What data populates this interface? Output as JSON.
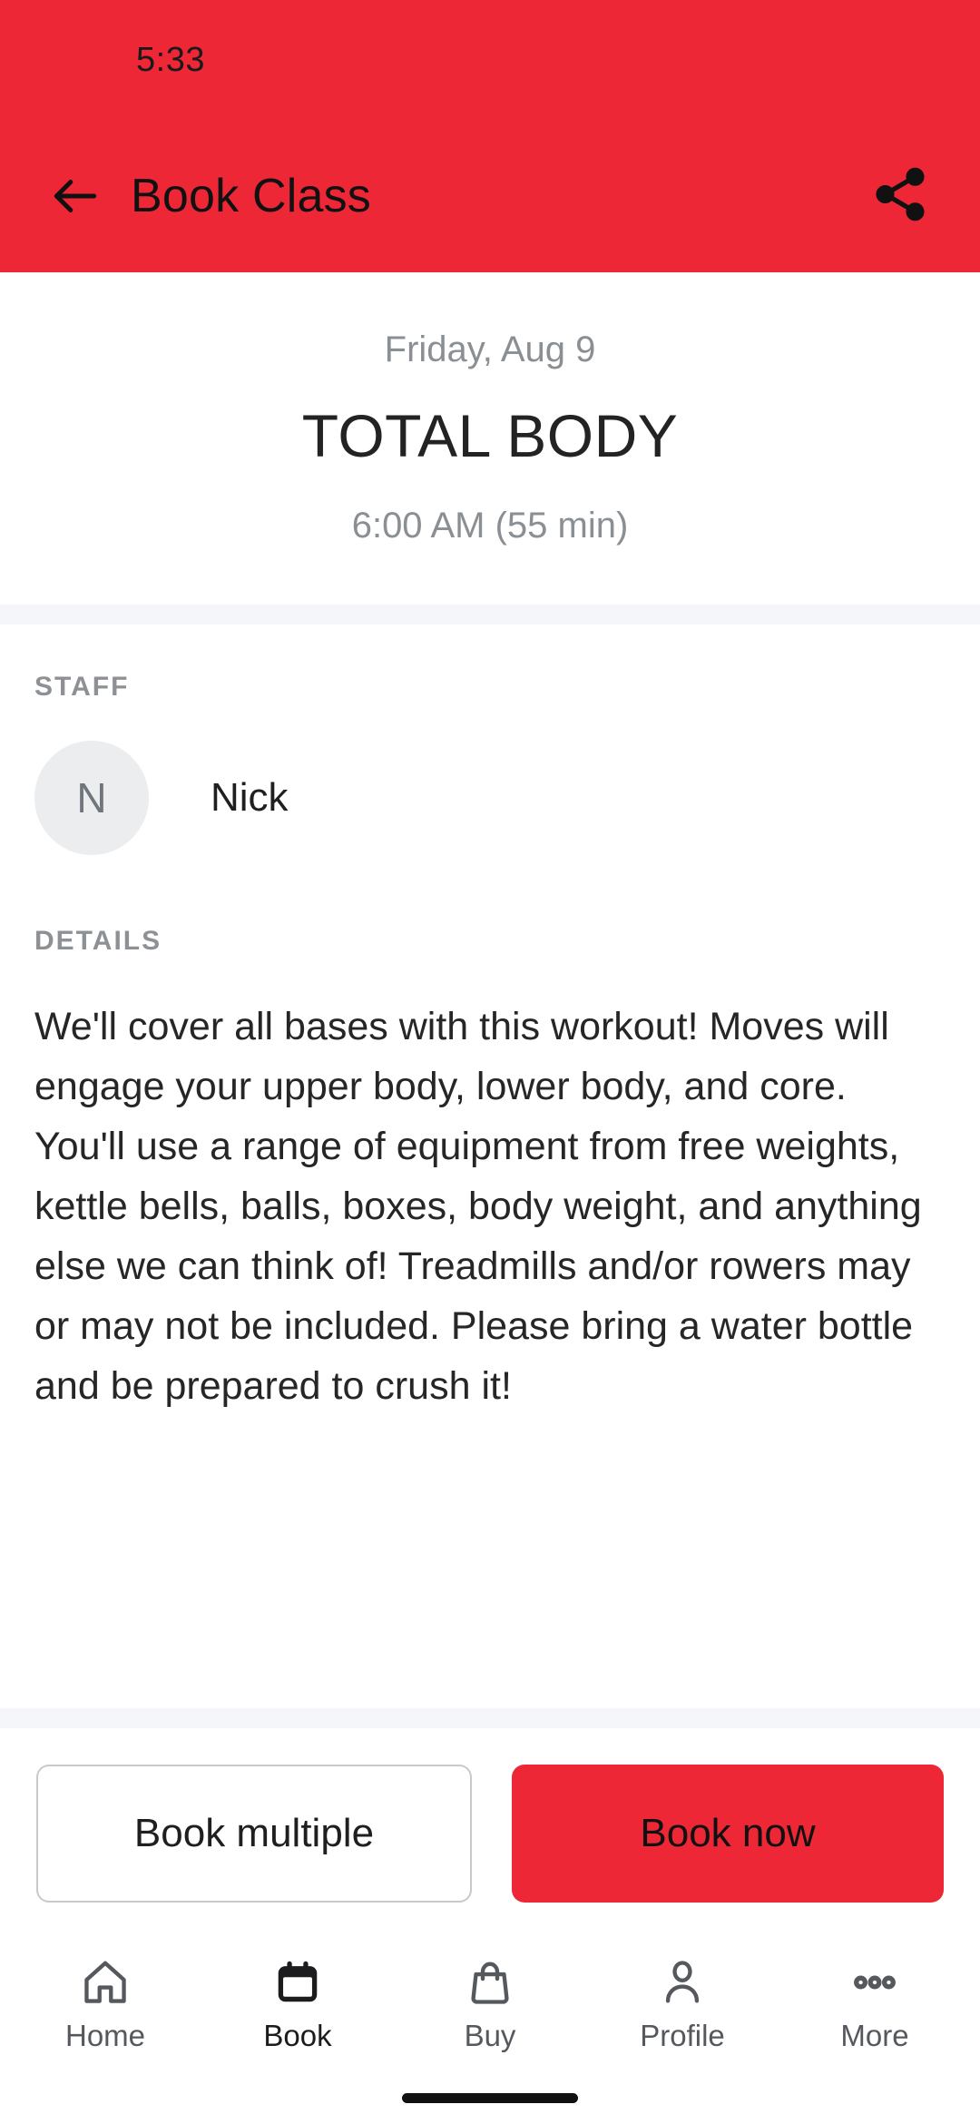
{
  "status_bar": {
    "time": "5:33"
  },
  "app_bar": {
    "title": "Book Class",
    "back_icon": "arrow-left-icon",
    "share_icon": "share-icon",
    "background_color": "#ee2737"
  },
  "hero": {
    "date": "Friday, Aug 9",
    "class_name": "TOTAL BODY",
    "time": "6:00 AM (55 min)"
  },
  "staff": {
    "label": "STAFF",
    "avatar_initial": "N",
    "name": "Nick"
  },
  "details": {
    "label": "DETAILS",
    "text": "We'll cover all bases with this workout! Moves will engage your upper body, lower body, and core. You'll use a range of equipment from free weights, kettle bells, balls, boxes, body weight, and anything else we can think of! Treadmills and/or rowers may or may not be included. Please bring a water bottle and be prepared to crush it!"
  },
  "actions": {
    "book_multiple_label": "Book multiple",
    "book_now_label": "Book now",
    "primary_color": "#ee2737"
  },
  "bottom_nav": {
    "items": [
      {
        "label": "Home",
        "icon": "home-icon",
        "active": false
      },
      {
        "label": "Book",
        "icon": "calendar-icon",
        "active": true
      },
      {
        "label": "Buy",
        "icon": "shopping-bag-icon",
        "active": false
      },
      {
        "label": "Profile",
        "icon": "person-icon",
        "active": false
      },
      {
        "label": "More",
        "icon": "ellipsis-icon",
        "active": false
      }
    ]
  }
}
